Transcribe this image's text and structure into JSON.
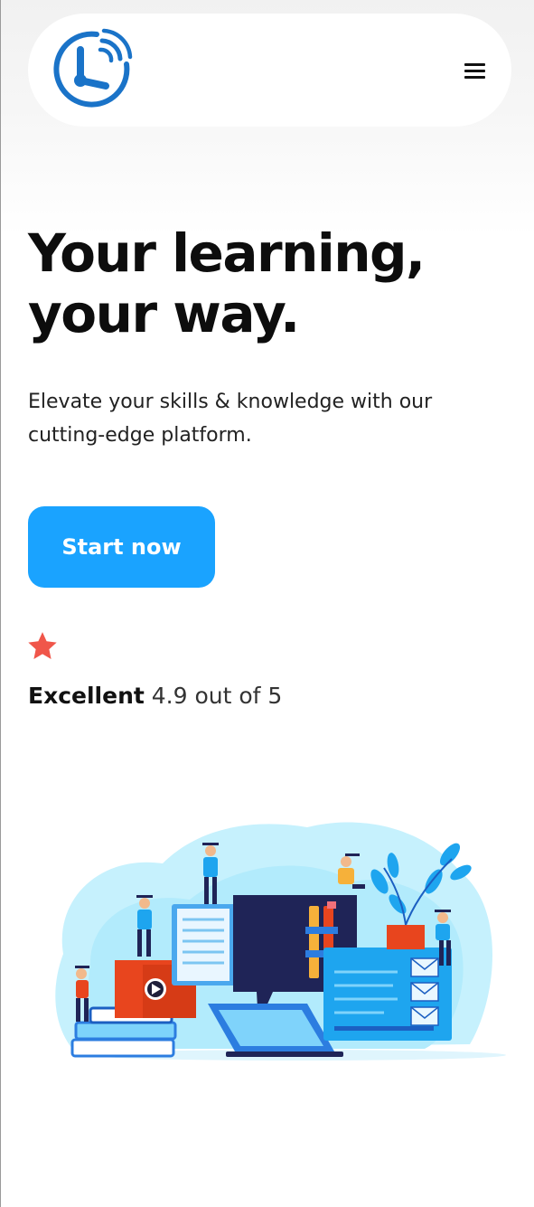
{
  "header": {
    "logo_icon": "clock-signal-logo-icon",
    "menu_icon": "hamburger-menu-icon"
  },
  "hero": {
    "title_line1": "Your learning,",
    "title_line2": "your way.",
    "subtitle": "Elevate your skills & knowledge with our cutting-edge platform.",
    "cta_label": "Start now"
  },
  "rating": {
    "star_icon": "star-icon",
    "label": "Excellent",
    "value_text": "4.9 out of 5",
    "score": 4.9,
    "max": 5
  },
  "illustration": {
    "icon": "online-learning-illustration"
  },
  "colors": {
    "accent": "#1aa3ff",
    "star": "#f0564a",
    "logo": "#1a73c8",
    "text": "#111111"
  }
}
